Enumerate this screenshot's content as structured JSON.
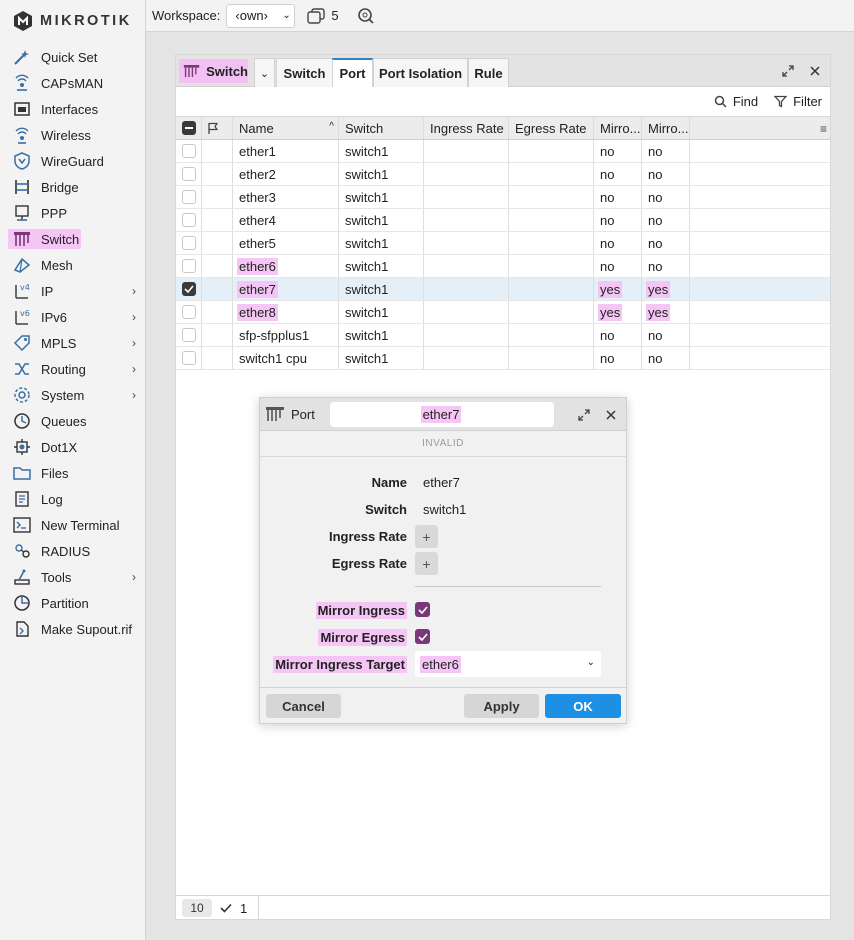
{
  "brand": {
    "logo_text": "MikroTik",
    "accent_color": "#f5c6f5",
    "ok_color": "#1e90e4"
  },
  "sidebar": {
    "items": [
      {
        "label": "Quick Set",
        "icon": "quick-set-icon",
        "has_submenu": false
      },
      {
        "label": "CAPsMAN",
        "icon": "capsman-icon",
        "has_submenu": false
      },
      {
        "label": "Interfaces",
        "icon": "interfaces-icon",
        "has_submenu": false
      },
      {
        "label": "Wireless",
        "icon": "wireless-icon",
        "has_submenu": false
      },
      {
        "label": "WireGuard",
        "icon": "wireguard-icon",
        "has_submenu": false
      },
      {
        "label": "Bridge",
        "icon": "bridge-icon",
        "has_submenu": false
      },
      {
        "label": "PPP",
        "icon": "ppp-icon",
        "has_submenu": false
      },
      {
        "label": "Switch",
        "icon": "switch-icon",
        "has_submenu": false,
        "active": true
      },
      {
        "label": "Mesh",
        "icon": "mesh-icon",
        "has_submenu": false
      },
      {
        "label": "IP",
        "icon": "ip-icon",
        "has_submenu": true
      },
      {
        "label": "IPv6",
        "icon": "ipv6-icon",
        "has_submenu": true
      },
      {
        "label": "MPLS",
        "icon": "mpls-icon",
        "has_submenu": true
      },
      {
        "label": "Routing",
        "icon": "routing-icon",
        "has_submenu": true
      },
      {
        "label": "System",
        "icon": "system-icon",
        "has_submenu": true
      },
      {
        "label": "Queues",
        "icon": "queues-icon",
        "has_submenu": false
      },
      {
        "label": "Dot1X",
        "icon": "dot1x-icon",
        "has_submenu": false
      },
      {
        "label": "Files",
        "icon": "files-icon",
        "has_submenu": false
      },
      {
        "label": "Log",
        "icon": "log-icon",
        "has_submenu": false
      },
      {
        "label": "New Terminal",
        "icon": "terminal-icon",
        "has_submenu": false
      },
      {
        "label": "RADIUS",
        "icon": "radius-icon",
        "has_submenu": false
      },
      {
        "label": "Tools",
        "icon": "tools-icon",
        "has_submenu": true
      },
      {
        "label": "Partition",
        "icon": "partition-icon",
        "has_submenu": false
      },
      {
        "label": "Make Supout.rif",
        "icon": "supout-icon",
        "has_submenu": false
      }
    ]
  },
  "topbar": {
    "workspace_label": "Workspace:",
    "workspace_value": "‹own›",
    "window_count": "5"
  },
  "window": {
    "title": "Switch",
    "tabs": [
      "Switch",
      "Port",
      "Port Isolation",
      "Rule"
    ],
    "active_tab": "Port",
    "toolbar": {
      "find_label": "Find",
      "filter_label": "Filter"
    },
    "table": {
      "columns": [
        "Name",
        "Switch",
        "Ingress Rate",
        "Egress Rate",
        "Mirro...",
        "Mirro..."
      ],
      "rows": [
        {
          "name": "ether1",
          "switch": "switch1",
          "ingress": "",
          "egress": "",
          "mirror_in": "no",
          "mirror_eg": "no",
          "selected": false
        },
        {
          "name": "ether2",
          "switch": "switch1",
          "ingress": "",
          "egress": "",
          "mirror_in": "no",
          "mirror_eg": "no",
          "selected": false
        },
        {
          "name": "ether3",
          "switch": "switch1",
          "ingress": "",
          "egress": "",
          "mirror_in": "no",
          "mirror_eg": "no",
          "selected": false
        },
        {
          "name": "ether4",
          "switch": "switch1",
          "ingress": "",
          "egress": "",
          "mirror_in": "no",
          "mirror_eg": "no",
          "selected": false
        },
        {
          "name": "ether5",
          "switch": "switch1",
          "ingress": "",
          "egress": "",
          "mirror_in": "no",
          "mirror_eg": "no",
          "selected": false
        },
        {
          "name": "ether6",
          "switch": "switch1",
          "ingress": "",
          "egress": "",
          "mirror_in": "no",
          "mirror_eg": "no",
          "selected": false,
          "hl_name": true
        },
        {
          "name": "ether7",
          "switch": "switch1",
          "ingress": "",
          "egress": "",
          "mirror_in": "yes",
          "mirror_eg": "yes",
          "selected": true,
          "hl_name": true,
          "hl_mirror": true
        },
        {
          "name": "ether8",
          "switch": "switch1",
          "ingress": "",
          "egress": "",
          "mirror_in": "yes",
          "mirror_eg": "yes",
          "selected": false,
          "hl_name": true,
          "hl_mirror": true
        },
        {
          "name": "sfp-sfpplus1",
          "switch": "switch1",
          "ingress": "",
          "egress": "",
          "mirror_in": "no",
          "mirror_eg": "no",
          "selected": false
        },
        {
          "name": "switch1 cpu",
          "switch": "switch1",
          "ingress": "",
          "egress": "",
          "mirror_in": "no",
          "mirror_eg": "no",
          "selected": false
        }
      ]
    },
    "status": {
      "total": "10",
      "selected": "1"
    }
  },
  "dialog": {
    "title": "Port",
    "name_value": "ether7",
    "status_text": "INVALID",
    "fields": {
      "name_label": "Name",
      "name_value": "ether7",
      "switch_label": "Switch",
      "switch_value": "switch1",
      "ingress_label": "Ingress Rate",
      "egress_label": "Egress Rate",
      "mirror_ingress_label": "Mirror Ingress",
      "mirror_ingress_checked": true,
      "mirror_egress_label": "Mirror Egress",
      "mirror_egress_checked": true,
      "target_label": "Mirror Ingress Target",
      "target_value": "ether6"
    },
    "buttons": {
      "cancel": "Cancel",
      "apply": "Apply",
      "ok": "OK"
    }
  }
}
